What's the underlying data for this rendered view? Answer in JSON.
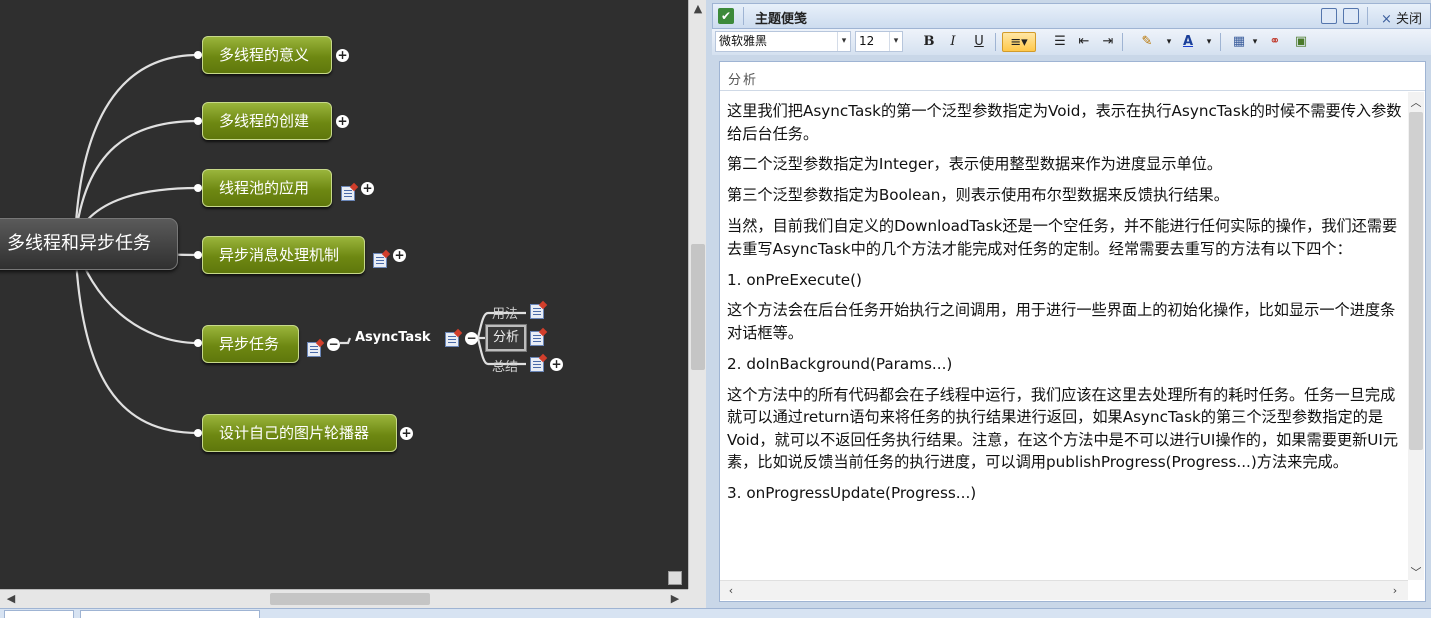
{
  "mindmap": {
    "central": "多线程和异步任务",
    "branches": [
      {
        "label": "多线程的意义"
      },
      {
        "label": "多线程的创建"
      },
      {
        "label": "线程池的应用"
      },
      {
        "label": "异步消息处理机制"
      },
      {
        "label": "异步任务"
      },
      {
        "label": "设计自己的图片轮播器"
      }
    ],
    "asynctask": {
      "label": "AsyncTask",
      "children": [
        "用法",
        "分析",
        "总结"
      ]
    },
    "expand_symbol": "+",
    "collapse_symbol": "−"
  },
  "notes": {
    "window_title": "主题便笺",
    "close_label": "关闭",
    "close_icon": "×",
    "font_name": "微软雅黑",
    "font_size": "12",
    "panel_title": "分析",
    "paragraphs": [
      "这里我们把AsyncTask的第一个泛型参数指定为Void，表示在执行AsyncTask的时候不需要传入参数给后台任务。",
      "第二个泛型参数指定为Integer，表示使用整型数据来作为进度显示单位。",
      "第三个泛型参数指定为Boolean，则表示使用布尔型数据来反馈执行结果。",
      "当然，目前我们自定义的DownloadTask还是一个空任务，并不能进行任何实际的操作，我们还需要去重写AsyncTask中的几个方法才能完成对任务的定制。经常需要去重写的方法有以下四个：",
      "1. onPreExecute()",
      "这个方法会在后台任务开始执行之间调用，用于进行一些界面上的初始化操作，比如显示一个进度条对话框等。",
      "2. doInBackground(Params...)",
      "这个方法中的所有代码都会在子线程中运行，我们应该在这里去处理所有的耗时任务。任务一旦完成就可以通过return语句来将任务的执行结果进行返回，如果AsyncTask的第三个泛型参数指定的是Void，就可以不返回任务执行结果。注意，在这个方法中是不可以进行UI操作的，如果需要更新UI元素，比如说反馈当前任务的执行进度，可以调用publishProgress(Progress...)方法来完成。",
      "3. onProgressUpdate(Progress...)"
    ]
  },
  "colors": {
    "canvas_bg": "#2f2f2f",
    "branch_node": "#6e8812",
    "link": "#e0e0e0",
    "highlight": "#ffc84a"
  }
}
